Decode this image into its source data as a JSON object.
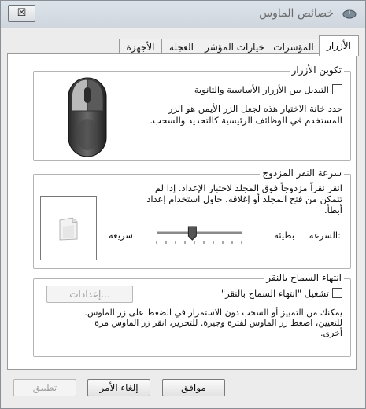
{
  "window": {
    "title": "خصائص الماوس",
    "close_label": "☒"
  },
  "tabs": [
    {
      "label": "الأزرار"
    },
    {
      "label": "المؤشرات"
    },
    {
      "label": "خيارات المؤشر"
    },
    {
      "label": "العجلة"
    },
    {
      "label": "الأجهزة"
    }
  ],
  "button_config": {
    "title": "تكوين الأزرار",
    "switch_checkbox_label": "التبديل بين الأزرار الأساسية والثانوية",
    "description_line1": "حدد خانة الاختيار هذه لجعل الزر الأيمن هو الزر",
    "description_line2": "المستخدم في الوظائف الرئيسية كالتحديد والسحب."
  },
  "double_click": {
    "title": "سرعة النقر المزدوج",
    "description_line1": "انقر نقراً مزدوجاً فوق المجلد لاختبار الإعداد. إذا لم",
    "description_line2": "تتمكن من فتح المجلد أو إغلاقه، حاول استخدام إعداد",
    "description_line3": "أبطأ.",
    "speed_label": "السرعة:",
    "slow_label": "بطيئة",
    "fast_label": "سريعة",
    "speed_value": 0.58
  },
  "click_lock": {
    "title": "انتهاء السماح بالنقر",
    "checkbox_label": "تشغيل \"انتهاء السماح بالنقر\"",
    "settings_button": "إعدادات...",
    "description_line1": "يمكنك من التمييز أو السحب دون الاستمرار في الضغط على زر الماوس.",
    "description_line2": "للتعيين، اضغط زر الماوس لفترة وجيزة. للتحرير، انقر زر الماوس مرة",
    "description_line3": "أخرى."
  },
  "footer": {
    "ok": "موافق",
    "cancel": "إلغاء الأمر",
    "apply": "تطبيق"
  }
}
